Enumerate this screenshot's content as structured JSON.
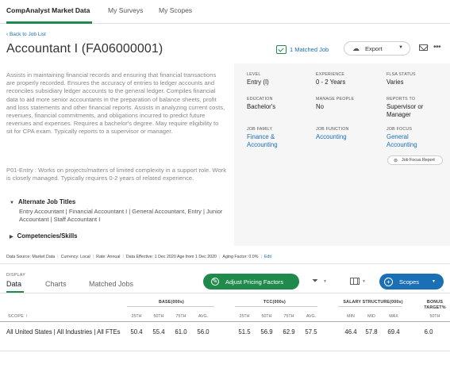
{
  "nav": {
    "tabs": [
      {
        "label": "CompAnalyst Market Data"
      },
      {
        "label": "My Surveys"
      },
      {
        "label": "My Scopes"
      }
    ]
  },
  "header": {
    "back_link": "‹ Back to Job List",
    "job_title": "Accountant I (FA06000001)",
    "matched_jobs": "1 Matched Job",
    "export_label": "Export"
  },
  "description": {
    "main": "Assists in maintaining financial records and ensuring that financial transactions are properly recorded. Ensures the accuracy of entries to ledger accounts and reconciles subsidiary ledger accounts to the general ledger. Compiles financial data to aid more senior accountants in the preparation of balance sheets, profit and loss statements and other financial reports. Assists in analyzing current costs, revenues, financial commitments, and obligations incurred to predict future revenues and expenses. Requires a bachelor's degree. May require eligibility to sit for CPA exam. Typically reports to a supervisor or manager.",
    "level_note": "P01-Entry : Works on projects/matters of limited complexity in a support role. Work is closely managed. Typically requires 0-2 years of related experience.",
    "alt_titles_heading": "Alternate Job Titles",
    "alt_titles": "Entry Accountant | Financial Accountant I | General Accountant, Entry | Junior Accountant | Staff Accountant I",
    "competencies_heading": "Competencies/Skills"
  },
  "attributes": {
    "level": {
      "label": "LEVEL",
      "value": "Entry (I)"
    },
    "experience": {
      "label": "EXPERIENCE",
      "value": "0 - 2 Years"
    },
    "flsa": {
      "label": "FLSA STATUS",
      "value": "Varies"
    },
    "education": {
      "label": "EDUCATION",
      "value": "Bachelor's"
    },
    "manage_people": {
      "label": "MANAGE PEOPLE",
      "value": "No"
    },
    "reports_to": {
      "label": "REPORTS TO",
      "value": "Supervisor or Manager"
    },
    "job_family": {
      "label": "JOB FAMILY",
      "value": "Finance & Accounting"
    },
    "job_function": {
      "label": "JOB FUNCTION",
      "value": "Accounting"
    },
    "job_focus": {
      "label": "JOB FOCUS",
      "value": "General Accounting"
    },
    "job_focus_report": "Job Focus Report"
  },
  "data_source": {
    "source": "Data Source: Market Data",
    "currency": "Currency: Local",
    "rate": "Rate: Annual",
    "effective": "Data Effective: 1 Dec 2020 Age from 1 Dec 2020",
    "aging": "Aging Factor: 0.0%",
    "edit": "Edit"
  },
  "display": {
    "label": "DISPLAY",
    "tabs": [
      {
        "label": "Data"
      },
      {
        "label": "Charts"
      },
      {
        "label": "Matched Jobs"
      }
    ],
    "adjust_button": "Adjust Pricing Factors",
    "scopes_button": "Scopes"
  },
  "table": {
    "groups": {
      "base": "BASE(000s)",
      "tcc": "TCC(000s)",
      "salary": "SALARY STRUCTURE(000s)",
      "bonus": "BONUS TARGET%"
    },
    "scope_header": "SCOPE",
    "sub_headers": {
      "base": [
        "25TH",
        "50TH",
        "75TH",
        "AVG."
      ],
      "tcc": [
        "25TH",
        "50TH",
        "75TH",
        "AVG."
      ],
      "salary": [
        "MIN",
        "MID",
        "MAX"
      ],
      "bonus": [
        "50TH"
      ]
    },
    "rows": [
      {
        "scope": "All United States | All Industries | All FTEs",
        "base": [
          "50.4",
          "55.4",
          "61.0",
          "56.0"
        ],
        "tcc": [
          "51.5",
          "56.9",
          "62.9",
          "57.5"
        ],
        "salary": [
          "46.4",
          "57.8",
          "69.4"
        ],
        "bonus": [
          "6.0"
        ]
      }
    ]
  },
  "colors": {
    "brand_green": "#1f8a4c",
    "link_blue": "#1a6fb5"
  }
}
